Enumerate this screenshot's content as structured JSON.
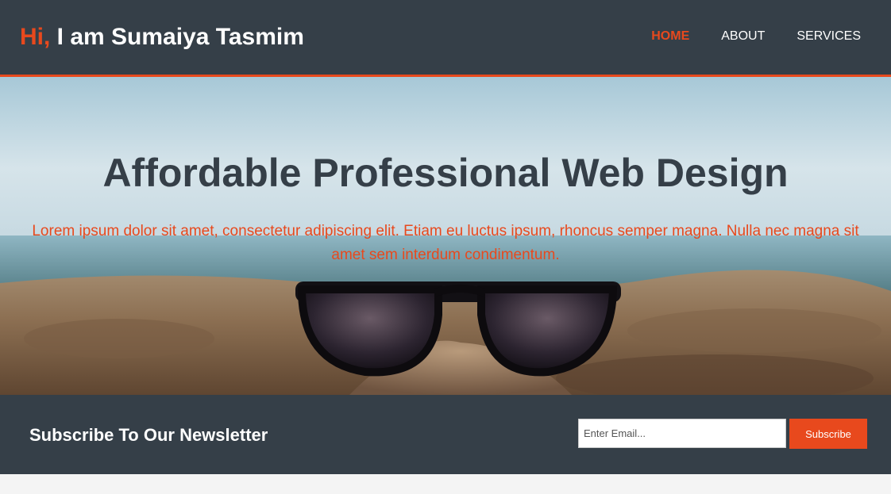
{
  "header": {
    "brand_highlight": "Hi,",
    "brand_rest": " I am Sumaiya Tasmim",
    "nav": [
      {
        "label": "HOME",
        "active": true
      },
      {
        "label": "ABOUT",
        "active": false
      },
      {
        "label": "SERVICES",
        "active": false
      }
    ]
  },
  "showcase": {
    "title": "Affordable Professional Web Design",
    "text": "Lorem ipsum dolor sit amet, consectetur adipiscing elit. Etiam eu luctus ipsum, rhoncus semper magna. Nulla nec magna sit amet sem interdum condimentum.",
    "image": "sunglasses-on-beach-sand"
  },
  "newsletter": {
    "title": "Subscribe To Our Newsletter",
    "email_placeholder": "Enter Email...",
    "email_value": "",
    "button_label": "Subscribe"
  },
  "colors": {
    "accent": "#e8491d",
    "dark": "#353f48",
    "light": "#f4f4f4"
  }
}
